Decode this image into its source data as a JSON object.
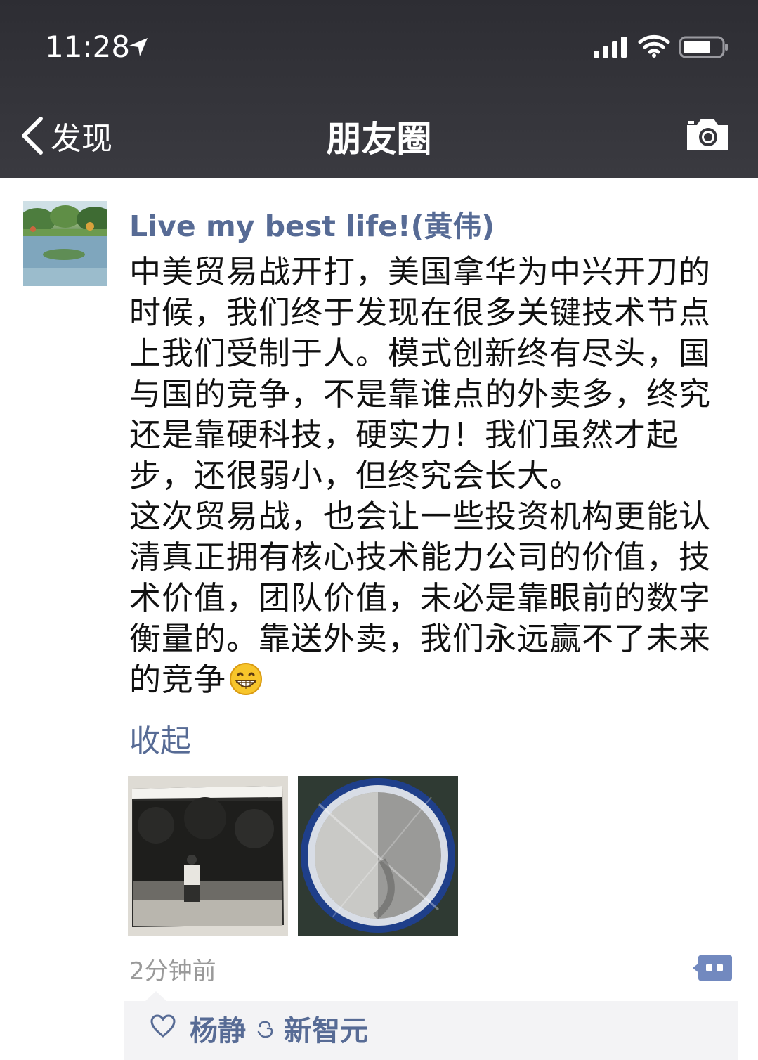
{
  "status_bar": {
    "time": "11:28"
  },
  "nav": {
    "back_label": "发现",
    "title": "朋友圈"
  },
  "post": {
    "author": "Live my best life!(黄伟)",
    "text": "中美贸易战开打，美国拿华为中兴开刀的\n时候，我们终于发现在很多关键技术节点\n上我们受制于人。模式创新终有尽头，国\n与国的竞争，不是靠谁点的外卖多，终究\n还是靠硬科技，硬实力！我们虽然才起\n步，还很弱小，但终究会长大。\n这次贸易战，也会让一些投资机构更能认\n清真正拥有核心技术能力公司的价值，技\n术价值，团队价值，未必是靠眼前的数字\n衡量的。靠送外卖，我们永远赢不了未来\n的竞争",
    "emoji": "grinning-face-emoji",
    "collapse_label": "收起",
    "time_ago": "2分钟前",
    "likes": [
      "杨静",
      "新智元"
    ]
  },
  "colors": {
    "nav_bg": "#35353b",
    "link_blue": "#576b95",
    "timestamp_gray": "#9a9a9a",
    "like_bg": "#f3f3f5"
  }
}
